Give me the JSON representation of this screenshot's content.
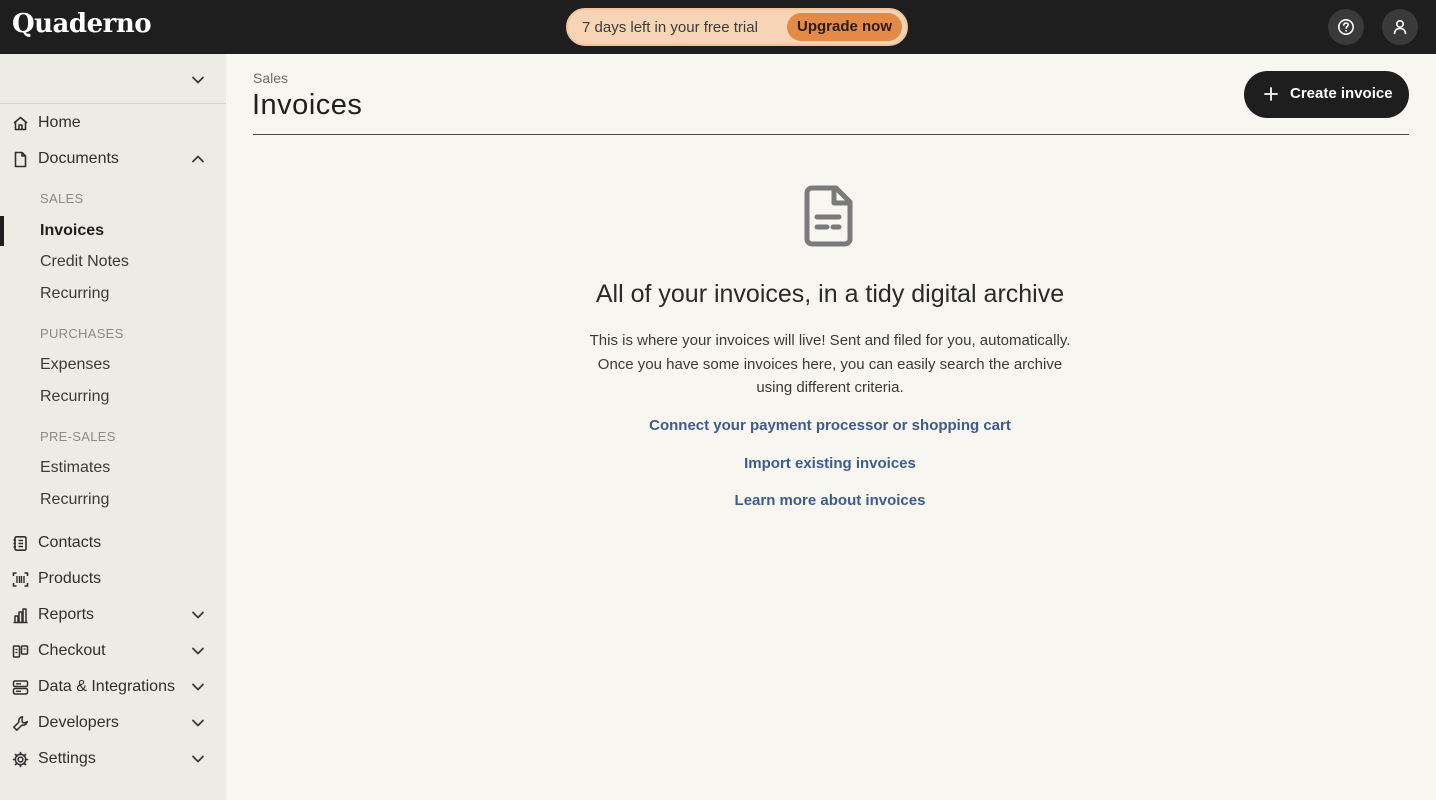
{
  "app": {
    "logo": "Quaderno"
  },
  "trial": {
    "text": "7 days left in your free trial",
    "upgrade_label": "Upgrade now"
  },
  "sidebar": {
    "organization": "",
    "items": [
      {
        "label": "Home",
        "icon": "home-icon"
      },
      {
        "label": "Documents",
        "icon": "document-icon",
        "expanded": true
      },
      {
        "label": "Contacts",
        "icon": "contacts-icon"
      },
      {
        "label": "Products",
        "icon": "products-icon"
      },
      {
        "label": "Reports",
        "icon": "bar-chart-icon",
        "expanded": false
      },
      {
        "label": "Checkout",
        "icon": "checkout-icon",
        "expanded": false
      },
      {
        "label": "Data & Integrations",
        "icon": "database-icon",
        "expanded": false
      },
      {
        "label": "Developers",
        "icon": "wrench-icon",
        "expanded": false
      },
      {
        "label": "Settings",
        "icon": "gear-icon",
        "expanded": false
      }
    ],
    "documents": {
      "sales_label": "SALES",
      "sales": [
        "Invoices",
        "Credit Notes",
        "Recurring"
      ],
      "purchases_label": "PURCHASES",
      "purchases": [
        "Expenses",
        "Recurring"
      ],
      "presales_label": "PRE-SALES",
      "presales": [
        "Estimates",
        "Recurring"
      ],
      "active": "Invoices"
    }
  },
  "main": {
    "breadcrumb": "Sales",
    "title": "Invoices",
    "create_label": "Create invoice",
    "empty": {
      "title": "All of your invoices, in a tidy digital archive",
      "description_lines": [
        "This is where your invoices will live! Sent and filed for you, automatically.",
        "Once you have some invoices here, you can easily search the archive",
        "using different criteria."
      ],
      "links": [
        "Connect your payment processor or shopping cart",
        "Import existing invoices",
        "Learn more about invoices"
      ]
    }
  },
  "colors": {
    "topbar": "#1e1e1e",
    "trial_bg": "#f7d4b6",
    "upgrade": "#e48a49",
    "link": "#3e5b8f",
    "background": "#f7f6f1",
    "sidebar": "#ecebe5"
  }
}
